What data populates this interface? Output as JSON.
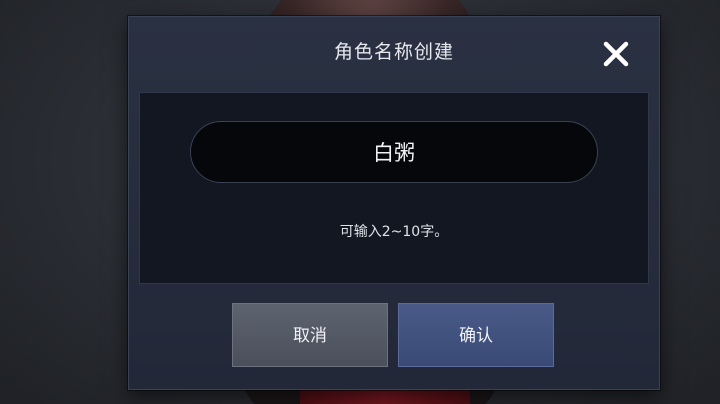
{
  "dialog": {
    "title": "角色名称创建",
    "close_icon": "close-icon"
  },
  "name_input": {
    "value": "白粥"
  },
  "hint": "可输入2~10字。",
  "buttons": {
    "cancel_label": "取消",
    "confirm_label": "确认"
  },
  "colors": {
    "dialog_bg": "#252c3c",
    "panel_bg": "#121722",
    "field_bg": "#05070b",
    "cancel_btn": "#555a66",
    "confirm_btn": "#42517e",
    "text": "#f0f1f4"
  }
}
